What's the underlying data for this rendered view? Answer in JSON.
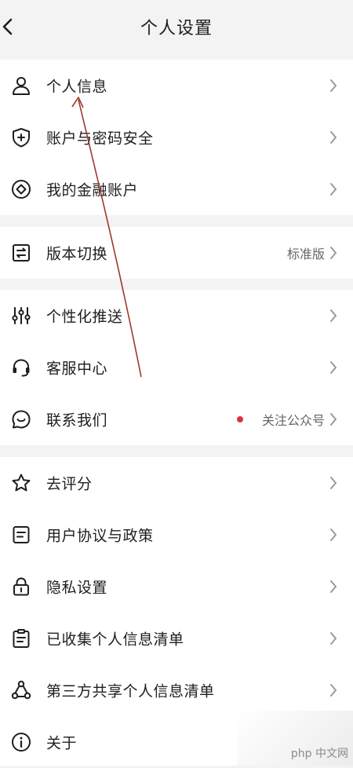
{
  "header": {
    "title": "个人设置",
    "back_icon": "chevron-left-icon"
  },
  "groups": [
    [
      {
        "label": "个人信息",
        "icon": "user-icon"
      },
      {
        "label": "账户与密码安全",
        "icon": "shield-plus-icon"
      },
      {
        "label": "我的金融账户",
        "icon": "diamond-circle-icon"
      }
    ],
    [
      {
        "label": "版本切换",
        "icon": "switch-icon",
        "value": "标准版"
      }
    ],
    [
      {
        "label": "个性化推送",
        "icon": "sliders-icon"
      },
      {
        "label": "客服中心",
        "icon": "headset-icon"
      },
      {
        "label": "联系我们",
        "icon": "chat-icon",
        "value": "关注公众号",
        "badge_color": "#d9333f"
      }
    ],
    [
      {
        "label": "去评分",
        "icon": "star-icon"
      },
      {
        "label": "用户协议与政策",
        "icon": "document-icon"
      },
      {
        "label": "隐私设置",
        "icon": "lock-icon"
      },
      {
        "label": "已收集个人信息清单",
        "icon": "clipboard-list-icon"
      },
      {
        "label": "第三方共享个人信息清单",
        "icon": "share-nodes-icon"
      },
      {
        "label": "关于",
        "icon": "info-icon"
      }
    ]
  ],
  "annotation_color": "#9b3a2a",
  "watermark": {
    "text": "php 中文网"
  }
}
